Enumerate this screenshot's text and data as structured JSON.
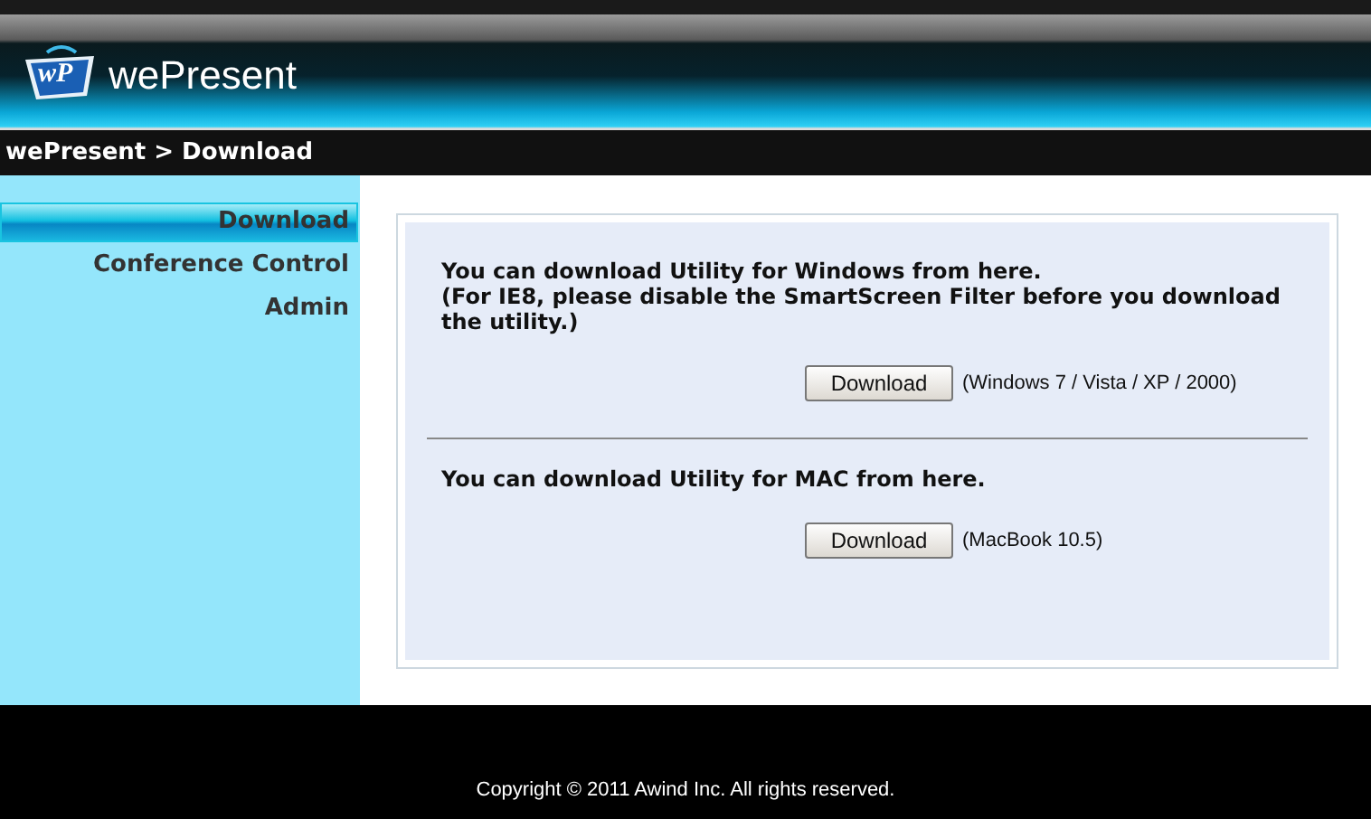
{
  "header": {
    "logo_mark": "wP",
    "brand": "wePresent"
  },
  "breadcrumb": "wePresent > Download",
  "sidebar": {
    "items": [
      {
        "label": "Download",
        "selected": true
      },
      {
        "label": "Conference Control",
        "selected": false
      },
      {
        "label": "Admin",
        "selected": false
      }
    ]
  },
  "sections": [
    {
      "lines": [
        "You can download Utility for Windows from here.",
        "(For IE8, please disable the SmartScreen Filter before you download the utility.)"
      ],
      "button": "Download",
      "note": "(Windows 7 / Vista / XP / 2000)"
    },
    {
      "lines": [
        "You can download Utility for MAC from here."
      ],
      "button": "Download",
      "note": "(MacBook 10.5)"
    }
  ],
  "footer": "Copyright © 2011 Awind Inc. All rights reserved."
}
